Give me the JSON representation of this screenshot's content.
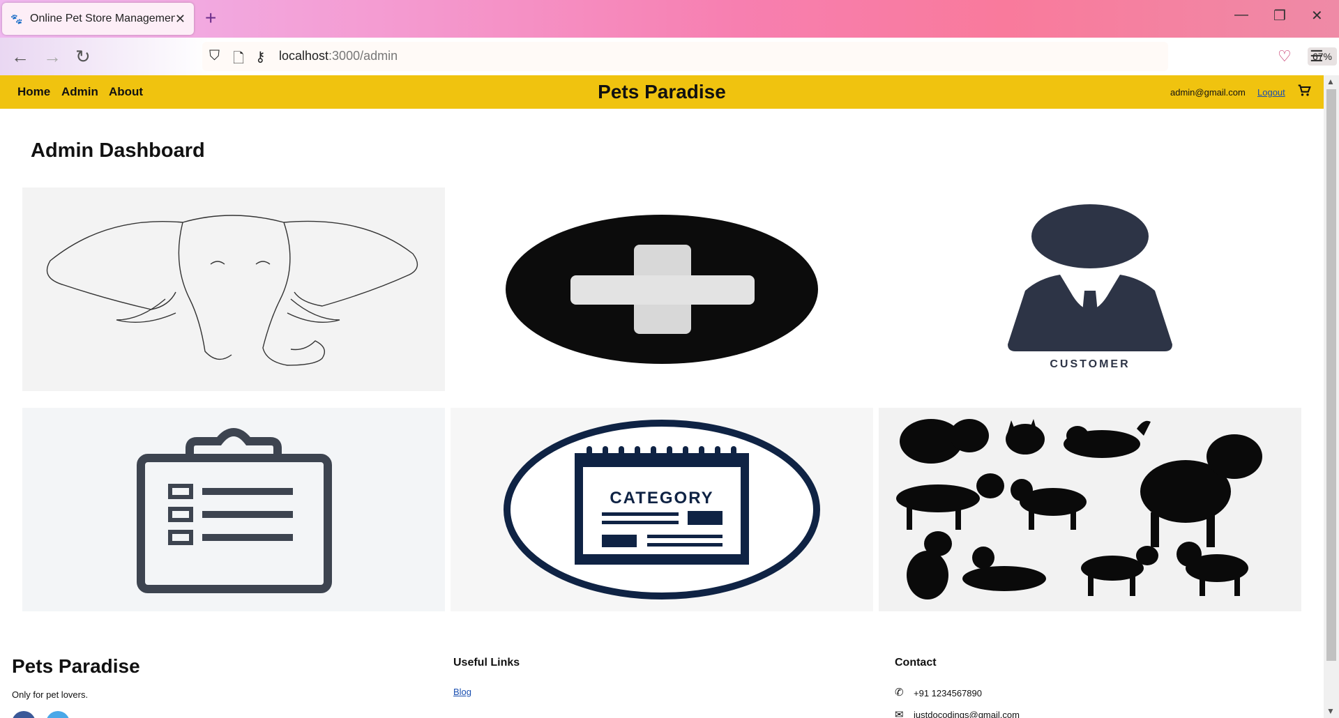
{
  "browser": {
    "tab_title": "Online Pet Store Management",
    "url_host": "localhost",
    "url_path": ":3000/admin",
    "zoom": "67%"
  },
  "header": {
    "nav": [
      "Home",
      "Admin",
      "About"
    ],
    "brand": "Pets Paradise",
    "email": "admin@gmail.com",
    "logout": "Logout"
  },
  "main": {
    "title": "Admin Dashboard",
    "cards": [
      {
        "name": "elephant-card"
      },
      {
        "name": "add-card"
      },
      {
        "name": "customer-card",
        "caption": "CUSTOMER"
      },
      {
        "name": "orders-card"
      },
      {
        "name": "category-card",
        "caption": "CATEGORY"
      },
      {
        "name": "pets-card"
      }
    ]
  },
  "footer": {
    "brand": "Pets Paradise",
    "tagline": "Only for pet lovers.",
    "useful_links_title": "Useful Links",
    "blog": "Blog",
    "contact_title": "Contact",
    "phone": "+91 1234567890",
    "email_partial": "justdocodings@gmail.com"
  },
  "colors": {
    "header": "#f0c30f",
    "link": "#1a4fb0"
  }
}
